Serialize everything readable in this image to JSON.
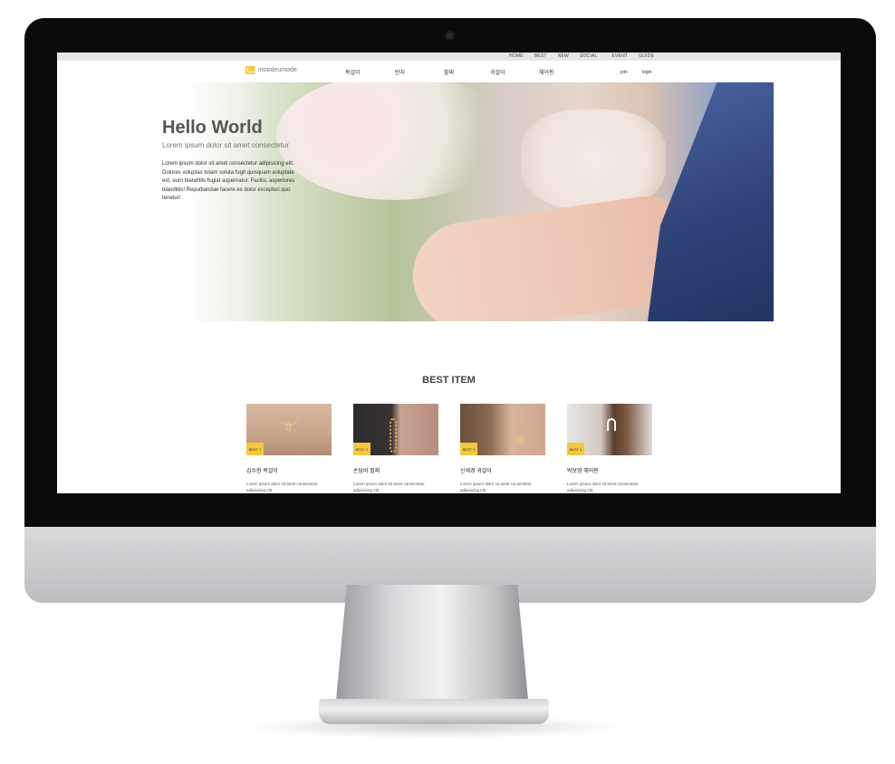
{
  "topbar": {
    "links": [
      "HOME",
      "BEST",
      "NEW",
      "SOCIAL",
      "EVENT",
      "GUIDE"
    ]
  },
  "nav": {
    "logo": "moodeumode",
    "menu": [
      "목걸이",
      "반지",
      "팔찌",
      "귀걸이",
      "헤어핀"
    ],
    "join": "join",
    "login": "login"
  },
  "hero": {
    "title": "Hello World",
    "subtitle": "Lorem ipsum dolor sit amet consectetur",
    "body": "Lorem ipsum dolor sit amet consectetur adipisicing elit. Dolores voluptas totam soluta fugit quisquam voluptate est, eum blanditiis fugiat aspernatur. Facilis, asperiores blanditiis! Repudiandae facere ex dolor excepturi quo tenetur!"
  },
  "best": {
    "title": "BEST ITEM",
    "items": [
      {
        "badge": "BEST 1",
        "name": "김수현 목걸이",
        "desc": "Lorem ipsum dolor sit amet consectetur adipisicing elit."
      },
      {
        "badge": "BEST 2",
        "name": "손담비 팔찌",
        "desc": "Lorem ipsum dolor sit amet consectetur adipisicing elit."
      },
      {
        "badge": "BEST 3",
        "name": "신세경 귀걸이",
        "desc": "Lorem ipsum dolor sit amet consectetur adipisicing elit."
      },
      {
        "badge": "BEST 4",
        "name": "박보영 헤어핀",
        "desc": "Lorem ipsum dolor sit amet consectetur adipisicing elit."
      }
    ]
  },
  "colors": {
    "accent": "#f3c93b",
    "bezel": "#0b0b0b",
    "topbar": "#e6e6e6"
  }
}
